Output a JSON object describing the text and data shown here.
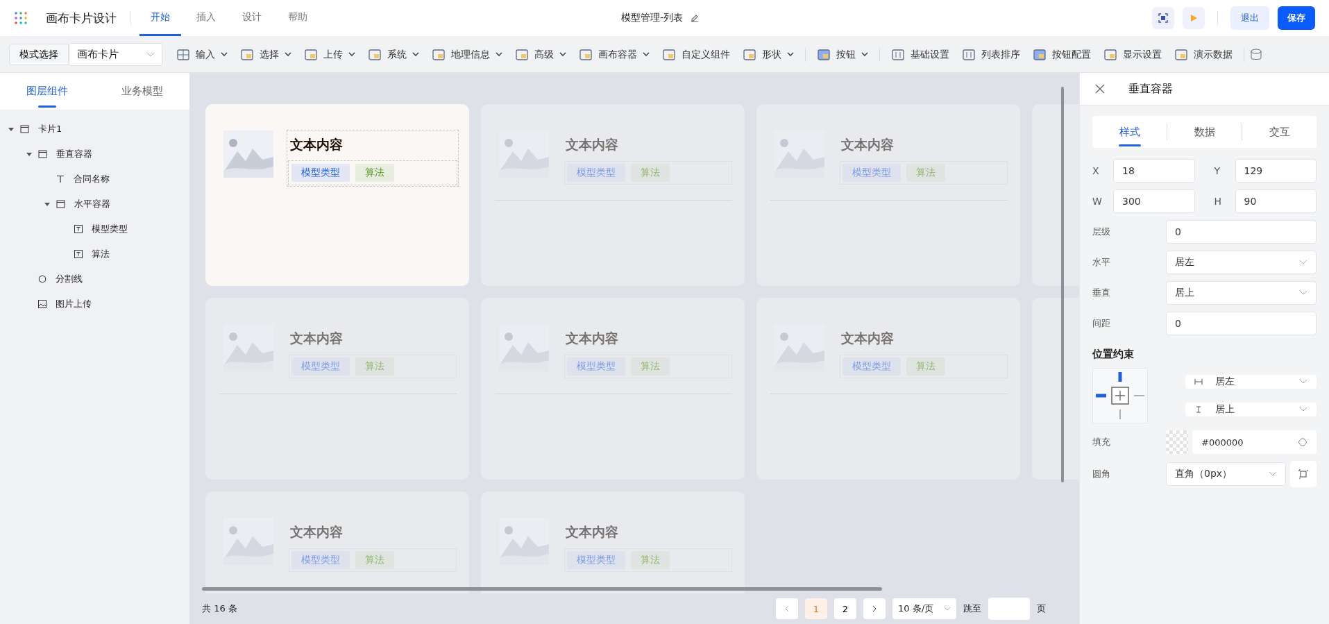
{
  "app": {
    "title": "画布卡片设计"
  },
  "nav_tabs": [
    {
      "label": "开始",
      "selected": true
    },
    {
      "label": "插入",
      "selected": false
    },
    {
      "label": "设计",
      "selected": false
    },
    {
      "label": "帮助",
      "selected": false
    }
  ],
  "document_title": "模型管理-列表",
  "header_buttons": {
    "exit": "退出",
    "save": "保存"
  },
  "toolbar": {
    "mode_button": "模式选择",
    "mode_select": "画布卡片",
    "items": [
      {
        "kind": "tool",
        "label": "输入",
        "has_menu": true
      },
      {
        "kind": "tool",
        "label": "选择",
        "has_menu": true
      },
      {
        "kind": "tool",
        "label": "上传",
        "has_menu": true
      },
      {
        "kind": "tool",
        "label": "系统",
        "has_menu": true
      },
      {
        "kind": "tool",
        "label": "地理信息",
        "has_menu": true
      },
      {
        "kind": "tool",
        "label": "高级",
        "has_menu": true
      },
      {
        "kind": "tool",
        "label": "画布容器",
        "has_menu": true
      },
      {
        "kind": "tool",
        "label": "自定义组件",
        "has_menu": false
      },
      {
        "kind": "tool",
        "label": "形状",
        "has_menu": true
      },
      {
        "kind": "divider"
      },
      {
        "kind": "tool",
        "label": "按钮",
        "has_menu": true
      },
      {
        "kind": "divider"
      },
      {
        "kind": "tool",
        "label": "基础设置",
        "has_menu": false
      },
      {
        "kind": "tool",
        "label": "列表排序",
        "has_menu": false
      },
      {
        "kind": "tool",
        "label": "按钮配置",
        "has_menu": false
      },
      {
        "kind": "tool",
        "label": "显示设置",
        "has_menu": false
      },
      {
        "kind": "tool",
        "label": "演示数据",
        "has_menu": false
      },
      {
        "kind": "divider"
      }
    ]
  },
  "left_panel": {
    "tabs": [
      {
        "label": "图层组件",
        "selected": true
      },
      {
        "label": "业务模型",
        "selected": false
      }
    ],
    "tree": [
      {
        "kind": "container",
        "label": "卡片1",
        "expanded": true,
        "children": [
          {
            "kind": "container",
            "label": "垂直容器",
            "expanded": true,
            "children": [
              {
                "kind": "text",
                "label": "合同名称"
              },
              {
                "kind": "container",
                "label": "水平容器",
                "expanded": true,
                "children": [
                  {
                    "kind": "textbox",
                    "label": "模型类型"
                  },
                  {
                    "kind": "textbox",
                    "label": "算法"
                  }
                ]
              }
            ]
          },
          {
            "kind": "divider",
            "label": "分割线"
          },
          {
            "kind": "image",
            "label": "图片上传"
          }
        ]
      }
    ]
  },
  "cards": [
    {
      "title": "文本内容",
      "selected": true,
      "tags": [
        {
          "label": "模型类型",
          "color": "#1f63e6"
        },
        {
          "label": "算法",
          "color": "#4f9a1c"
        }
      ]
    },
    {
      "title": "文本内容",
      "selected": false,
      "tags": [
        {
          "label": "模型类型",
          "color": "#7c9be6"
        },
        {
          "label": "算法",
          "color": "#8fb56f"
        }
      ]
    },
    {
      "title": "文本内容",
      "selected": false,
      "tags": [
        {
          "label": "模型类型",
          "color": "#7c9be6"
        },
        {
          "label": "算法",
          "color": "#8fb56f"
        }
      ]
    },
    {
      "title": "文本内容",
      "selected": false,
      "tags": [
        {
          "label": "模型类型",
          "color": "#7c9be6"
        },
        {
          "label": "算法",
          "color": "#8fb56f"
        }
      ]
    },
    {
      "title": "文本内容",
      "selected": false,
      "tags": [
        {
          "label": "模型类型",
          "color": "#7c9be6"
        },
        {
          "label": "算法",
          "color": "#8fb56f"
        }
      ]
    },
    {
      "title": "文本内容",
      "selected": false,
      "tags": [
        {
          "label": "模型类型",
          "color": "#7c9be6"
        },
        {
          "label": "算法",
          "color": "#8fb56f"
        }
      ]
    },
    {
      "title": "文本内容",
      "selected": false,
      "tags": [
        {
          "label": "模型类型",
          "color": "#7c9be6"
        },
        {
          "label": "算法",
          "color": "#8fb56f"
        }
      ]
    },
    {
      "title": "文本内容",
      "selected": false,
      "tags": [
        {
          "label": "模型类型",
          "color": "#7c9be6"
        },
        {
          "label": "算法",
          "color": "#8fb56f"
        }
      ]
    }
  ],
  "pagination": {
    "total": "共 16 条",
    "pages": [
      {
        "label": "1",
        "selected": true
      },
      {
        "label": "2",
        "selected": false
      }
    ],
    "page_size": "10 条/页",
    "jump_label": "跳至",
    "page_unit": "页"
  },
  "right_panel": {
    "title": "垂直容器",
    "tabs": [
      {
        "label": "样式",
        "selected": true
      },
      {
        "label": "数据",
        "selected": false
      },
      {
        "label": "交互",
        "selected": false
      }
    ],
    "coords": [
      {
        "label": "X",
        "value": "18"
      },
      {
        "label": "Y",
        "value": "129"
      },
      {
        "label": "W",
        "value": "300"
      },
      {
        "label": "H",
        "value": "90"
      }
    ],
    "rows": [
      {
        "kind": "input",
        "label": "层级",
        "value": "0"
      },
      {
        "kind": "select",
        "label": "水平",
        "value": "居左"
      },
      {
        "kind": "select",
        "label": "垂直",
        "value": "居上"
      },
      {
        "kind": "input",
        "label": "间距",
        "value": "0"
      }
    ],
    "constraint": {
      "title": "位置约束",
      "top": true,
      "left": true,
      "right": false,
      "bottom": false,
      "horizontal": "居左",
      "vertical": "居上"
    },
    "fill": {
      "label": "填充",
      "value": "#000000"
    },
    "radius": {
      "label": "圆角",
      "value": "直角（0px）"
    }
  }
}
